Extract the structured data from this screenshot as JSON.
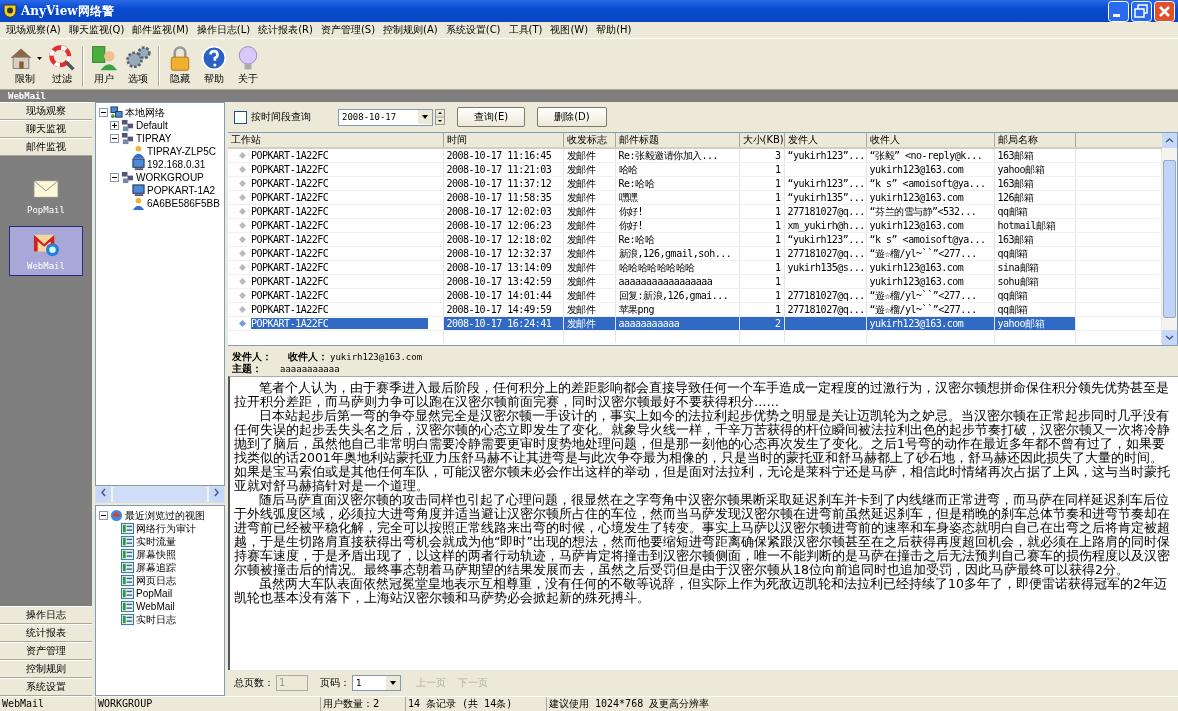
{
  "window": {
    "title": "AnyView网络警"
  },
  "menu": [
    "现场观察(A)",
    "聊天监视(Q)",
    "邮件监视(M)",
    "操作日志(L)",
    "统计报表(R)",
    "资产管理(S)",
    "控制规则(A)",
    "系统设置(C)",
    "工具(T)",
    "视图(W)",
    "帮助(H)"
  ],
  "toolbar_groups": [
    {
      "buttons": [
        {
          "label": "限制",
          "dropdown": true
        },
        {
          "label": "过滤",
          "dropdown": false
        }
      ]
    },
    {
      "buttons": [
        {
          "label": "用户",
          "dropdown": false
        },
        {
          "label": "选项",
          "dropdown": false
        }
      ]
    },
    {
      "buttons": [
        {
          "label": "隐藏",
          "dropdown": false
        },
        {
          "label": "帮助",
          "dropdown": false
        },
        {
          "label": "关于",
          "dropdown": false
        }
      ]
    }
  ],
  "section_header": "WebMail",
  "nav": {
    "top": [
      "现场观察",
      "聊天监视",
      "邮件监视"
    ],
    "items": [
      {
        "label": "PopMail",
        "selected": false
      },
      {
        "label": "WebMail",
        "selected": true
      }
    ],
    "bottom": [
      "操作日志",
      "统计报表",
      "资产管理",
      "控制规则",
      "系统设置"
    ]
  },
  "network_tree": {
    "label": "本地网络",
    "kind": "network",
    "expanded": true,
    "children": [
      {
        "label": "Default",
        "kind": "group",
        "expanded": false
      },
      {
        "label": "TIPRAY",
        "kind": "group",
        "expanded": true,
        "children": [
          {
            "label": "TIPRAY-ZLP5C",
            "kind": "user"
          },
          {
            "label": "192.168.0.31",
            "kind": "computer"
          }
        ]
      },
      {
        "label": "WORKGROUP",
        "kind": "group",
        "expanded": true,
        "children": [
          {
            "label": "POPKART-1A2",
            "kind": "computer"
          },
          {
            "label": "6A6BE586F5BB",
            "kind": "user"
          }
        ]
      }
    ]
  },
  "recent_tree": {
    "label": "最近浏览过的视图",
    "kind": "recent",
    "expanded": true,
    "children": [
      {
        "label": "网络行为审计",
        "kind": "view"
      },
      {
        "label": "实时流量",
        "kind": "view"
      },
      {
        "label": "屏幕快照",
        "kind": "view"
      },
      {
        "label": "屏幕追踪",
        "kind": "view"
      },
      {
        "label": "网页日志",
        "kind": "view"
      },
      {
        "label": "PopMail",
        "kind": "view"
      },
      {
        "label": "WebMail",
        "kind": "view"
      },
      {
        "label": "实时日志",
        "kind": "view"
      }
    ]
  },
  "filter": {
    "label": "按时间段查询",
    "checked": false,
    "date": "2008-10-17",
    "buttons": [
      "查询(E)",
      "删除(D)"
    ]
  },
  "table": {
    "columns": [
      "工作站",
      "时间",
      "收发标志",
      "邮件标题",
      "大小(KB)",
      "发件人",
      "收件人",
      "邮局名称"
    ],
    "rows": [
      {
        "selected": false,
        "cells": [
          "POPKART-1A22FC",
          "2008-10-17 11:16:45",
          "发邮件",
          "Re:张毅邀请你加入...",
          "3",
          "“yukirh123”...",
          "“张毅” <no-reply@k...",
          "163邮箱"
        ]
      },
      {
        "selected": false,
        "cells": [
          "POPKART-1A22FC",
          "2008-10-17 11:21:03",
          "发邮件",
          "哈哈",
          "1",
          "",
          "yukirh123@163.com",
          "yahoo邮箱"
        ]
      },
      {
        "selected": false,
        "cells": [
          "POPKART-1A22FC",
          "2008-10-17 11:37:12",
          "发邮件",
          "Re:哈哈",
          "1",
          "“yukirh123”...",
          "“k s” <amoisoft@ya...",
          "163邮箱"
        ]
      },
      {
        "selected": false,
        "cells": [
          "POPKART-1A22FC",
          "2008-10-17 11:58:35",
          "发邮件",
          "嘿嘿",
          "1",
          "“yukirh135”...",
          "yukirh123@163.com",
          "126邮箱"
        ]
      },
      {
        "selected": false,
        "cells": [
          "POPKART-1A22FC",
          "2008-10-17 12:02:03",
          "发邮件",
          "你好!",
          "1",
          "277181027@q...",
          "“芬兰的雪与静”<532...",
          "qq邮箱"
        ]
      },
      {
        "selected": false,
        "cells": [
          "POPKART-1A22FC",
          "2008-10-17 12:06:23",
          "发邮件",
          "你好!",
          "1",
          "xm_yukirh@h...",
          "yukirh123@163.com",
          "hotmail邮箱"
        ]
      },
      {
        "selected": false,
        "cells": [
          "POPKART-1A22FC",
          "2008-10-17 12:18:02",
          "发邮件",
          "Re:哈哈",
          "1",
          "“yukirh123”...",
          "“k s” <amoisoft@ya...",
          "163邮箱"
        ]
      },
      {
        "selected": false,
        "cells": [
          "POPKART-1A22FC",
          "2008-10-17 12:32:37",
          "发邮件",
          "新浪,126,gmail,soh...",
          "1",
          "277181027@q...",
          "“遊☆榴/yl~``”<277...",
          "qq邮箱"
        ]
      },
      {
        "selected": false,
        "cells": [
          "POPKART-1A22FC",
          "2008-10-17 13:14:09",
          "发邮件",
          "哈哈哈哈哈哈哈哈",
          "1",
          "yukirh135@s...",
          "yukirh123@163.com",
          "sina邮箱"
        ]
      },
      {
        "selected": false,
        "cells": [
          "POPKART-1A22FC",
          "2008-10-17 13:42:59",
          "发邮件",
          "aaaaaaaaaaaaaaaaa",
          "1",
          "",
          "yukirh123@163.com",
          "sohu邮箱"
        ]
      },
      {
        "selected": false,
        "cells": [
          "POPKART-1A22FC",
          "2008-10-17 14:01:44",
          "发邮件",
          "回复:新浪,126,gmai...",
          "1",
          "277181027@q...",
          "“遊☆榴/yl~``”<277...",
          "qq邮箱"
        ]
      },
      {
        "selected": false,
        "cells": [
          "POPKART-1A22FC",
          "2008-10-17 14:49:59",
          "发邮件",
          "苹果png",
          "1",
          "277181027@q...",
          "“遊☆榴/yl~``”<277...",
          "qq邮箱"
        ]
      },
      {
        "selected": true,
        "cells": [
          "POPKART-1A22FC",
          "2008-10-17 16:24:41",
          "发邮件",
          "aaaaaaaaaaa",
          "2",
          "",
          "yukirh123@163.com",
          "yahoo邮箱"
        ]
      }
    ]
  },
  "preview": {
    "sender_label": "发件人：",
    "recipient_label": "收件人：",
    "recipient": "yukirh123@163.com",
    "subject_label": "主题：",
    "subject": "aaaaaaaaaaa",
    "body": [
      "笔者个人认为，由于赛季进入最后阶段，任何积分上的差距影响都会直接导致任何一个车手造成一定程度的过激行为，汉密尔顿想拼命保住积分领先优势甚至是拉开积分差距，而马萨则力争可以跑在汉密尔顿前面完赛，同时汉密尔顿最好不要获得积分……",
      "日本站起步后第一弯的争夺显然完全是汉密尔顿一手设计的，事实上如今的法拉利起步优势之明显是关让迈凯轮为之妒忌。当汉密尔顿在正常起步同时几乎没有任何失误的起步丢失头名之后，汉密尔顿的心态立即发生了变化。就象导火线一样，千辛万苦获得的杆位瞬间被法拉利出色的起步节奏打破，汉密尔顿又一次将冷静抛到了脑后，虽然他自己非常明白需要冷静需要更审时度势地处理问题，但是那一刻他的心态再次发生了变化。之后1号弯的动作在最近多年都不曾有过了，如果要找类似的话2001年奥地利站蒙托亚力压舒马赫不让其进弯是与此次争夺最为相像的，只是当时的蒙托亚和舒马赫都上了砂石地，舒马赫还因此损失了大量的时间。如果是宝马索伯或是其他任何车队，可能汉密尔顿未必会作出这样的举动，但是面对法拉利，无论是莱科宁还是马萨，相信此时情绪再次占据了上风，这与当时蒙托亚就对舒马赫搞针对是一个道理。",
      "随后马萨直面汉密尔顿的攻击同样也引起了心理问题，很显然在之字弯角中汉密尔顿果断采取延迟刹车并卡到了内线继而正常进弯，而马萨在同样延迟刹车后位于外线弧度区域，必须拉大进弯角度并适当避让汉密尔顿所占住的车位，然而当马萨发现汉密尔顿在进弯前虽然延迟刹车，但是稍晚的刹车总体节奏和进弯节奏却在进弯前已经被平稳化解，完全可以按照正常线路来出弯的时候，心境发生了转变。事实上马萨以汉密尔顿进弯前的速率和车身姿态就明白自己在出弯之后将肯定被超越，于是生切路肩直接获得出弯机会就成为他“即时”出现的想法，然而他要缩短进弯距离确保紧跟汉密尔顿甚至在之后获得再度超回机会，就必须在上路肩的同时保持赛车速度，于是矛盾出现了，以这样的两者行动轨迹，马萨肯定将撞击到汉密尔顿侧面，唯一不能判断的是马萨在撞击之后无法预判自己赛车的损伤程度以及汉密尔顿被撞击后的情况。最终事态朝着马萨期望的结果发展而去，虽然之后受罚但是由于汉密尔顿从18位向前追同时也追加受罚，因此马萨最终可以获得2分。",
      "虽然两大车队表面依然冠冕堂皇地表示互相尊重，没有任何的不敬等说辞，但实际上作为死敌迈凯轮和法拉利已经持续了10多年了，即便雷诺获得冠军的2年迈凯轮也基本没有落下，上海站汉密尔顿和马萨势必会掀起新的殊死搏斗。"
    ]
  },
  "pager": {
    "total_label": "总页数：",
    "total": "1",
    "page_label": "页码：",
    "page": "1",
    "prev": "上一页",
    "next": "下一页",
    "prev_disabled": true,
    "next_disabled": true
  },
  "status_bar": [
    "WebMail",
    "WORKGROUP",
    "用户数量：2",
    "14 条记录 (共 14条)",
    "建议使用 1024*768 及更高分辨率"
  ]
}
